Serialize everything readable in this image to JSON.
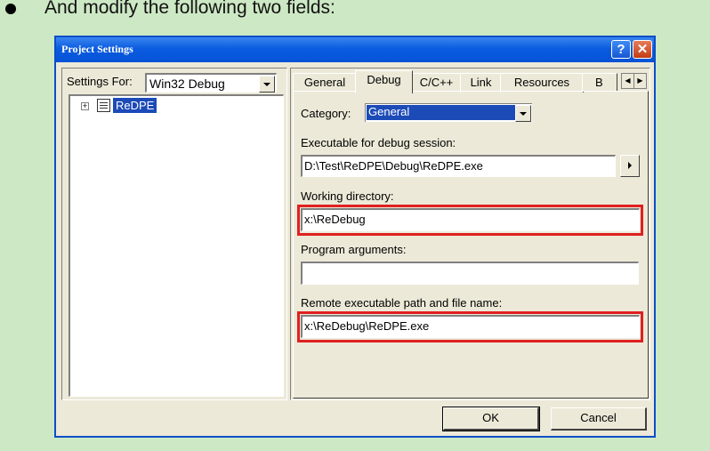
{
  "instruction": "And modify the following two fields:",
  "dialog": {
    "title": "Project Settings",
    "help_glyph": "?",
    "close_glyph": "✕"
  },
  "left": {
    "settings_for_label": "Settings For:",
    "settings_for_value": "Win32 Debug",
    "tree_expander": "+",
    "tree_project": "ReDPE"
  },
  "tabs": [
    "General",
    "Debug",
    "C/C++",
    "Link",
    "Resources",
    "B"
  ],
  "active_tab": "Debug",
  "debug": {
    "category_label": "Category:",
    "category_value": "General",
    "exec_label": "Executable for debug session:",
    "exec_value": "D:\\Test\\ReDPE\\Debug\\ReDPE.exe",
    "workdir_label": "Working directory:",
    "workdir_value": "x:\\ReDebug",
    "args_label": "Program arguments:",
    "args_value": "",
    "remote_label": "Remote executable path and file name:",
    "remote_value": "x:\\ReDebug\\ReDPE.exe"
  },
  "buttons": {
    "ok": "OK",
    "cancel": "Cancel"
  },
  "colors": {
    "highlight": "#e02020",
    "selection": "#1c4bb8",
    "titlebar": "#0b5ce0",
    "background": "#cde8c4"
  },
  "icons": [
    "bullet-icon",
    "help-icon",
    "close-icon",
    "dropdown-arrow-icon",
    "project-icon",
    "browse-arrow-icon",
    "tab-scroll-left-icon",
    "tab-scroll-right-icon"
  ]
}
